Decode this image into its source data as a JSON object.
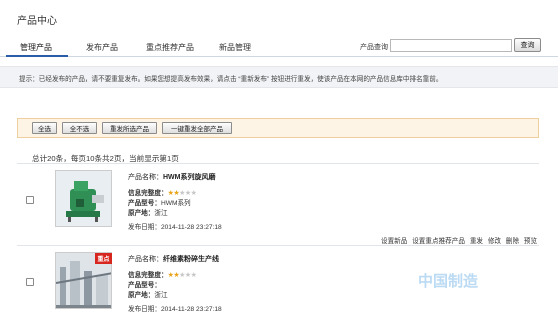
{
  "page": {
    "title": "产品中心"
  },
  "tabs": [
    {
      "label": "管理产品",
      "active": true
    },
    {
      "label": "发布产品"
    },
    {
      "label": "重点推荐产品"
    },
    {
      "label": "新品管理"
    }
  ],
  "search": {
    "label": "产品查询",
    "value": "",
    "button": "查询"
  },
  "tip": "提示：已经发布的产品，请不要重复发布。如果您想提高发布效果，请点击 “重新发布” 按钮进行重发，使该产品在本网的产品信息库中排名靠前。",
  "actions": {
    "select_all": "全选",
    "select_none": "全不选",
    "republish_selected": "重发所选产品",
    "republish_all": "一键重发全部产品"
  },
  "summary": "总计20条，每页10条共2页，当前显示第1页",
  "colors": {
    "accent": "#2b5ca8",
    "star": "#e8a317",
    "badge": "#d7261e",
    "action_bar_bg": "#fdf4e6"
  },
  "products": [
    {
      "name_label": "产品名称：",
      "name": "HWM系列旋风磨",
      "completeness_label": "信息完整度：",
      "completeness_stars": 2,
      "model_label": "产品型号：",
      "model": "HWM系列",
      "origin_label": "原产地：",
      "origin": "浙江",
      "date_label": "发布日期：",
      "date": "2014-11-28 23:27:18",
      "thumb_icon": "machine-photo"
    },
    {
      "name_label": "产品名称：",
      "name": "纤维素粉碎生产线",
      "completeness_label": "信息完整度：",
      "completeness_stars": 2,
      "model_label": "产品型号：",
      "model": "",
      "origin_label": "原产地：",
      "origin": "浙江",
      "date_label": "发布日期：",
      "date": "2014-11-28 23:27:18",
      "badge": "重点",
      "thumb_icon": "production-line-photo"
    }
  ],
  "row_actions": [
    "设置新品",
    "设置重点推荐产品",
    "重发",
    "修改",
    "删除",
    "预览"
  ],
  "watermark": "中国制造"
}
